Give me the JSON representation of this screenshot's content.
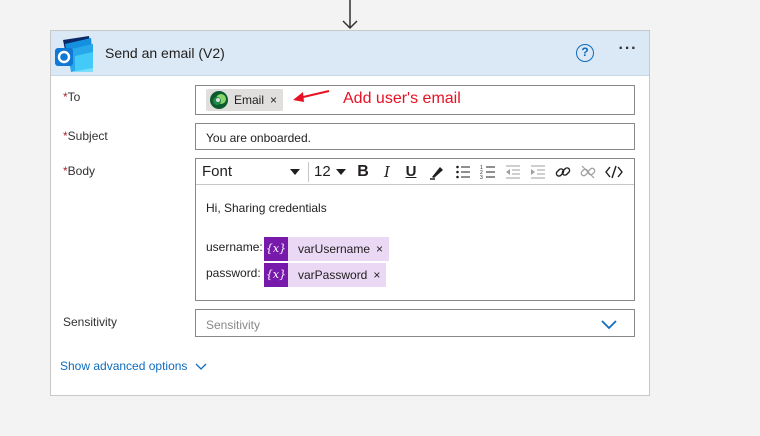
{
  "card": {
    "title": "Send an email (V2)",
    "help_glyph": "?",
    "more_glyph": "···"
  },
  "fields": {
    "to": {
      "label": "To",
      "required_mark": "*",
      "token_label": "Email",
      "token_remove": "×"
    },
    "subject": {
      "label": "Subject",
      "required_mark": "*",
      "value": "You are onboarded."
    },
    "body": {
      "label": "Body",
      "required_mark": "*",
      "toolbar": {
        "font": "Font",
        "size": "12",
        "bold": "B",
        "italic": "I",
        "underline": "U"
      },
      "greeting": "Hi, Sharing credentials",
      "rows": [
        {
          "label": "username:",
          "token": "varUsername",
          "fx": "{x}",
          "remove": "×"
        },
        {
          "label": "password:",
          "token": "varPassword",
          "fx": "{x}",
          "remove": "×"
        }
      ]
    },
    "sensitivity": {
      "label": "Sensitivity",
      "placeholder": "Sensitivity"
    }
  },
  "annotation": {
    "text": "Add user's email",
    "color": "#e81123"
  },
  "advanced": {
    "label": "Show advanced options"
  },
  "colors": {
    "accent": "#0f6cbd",
    "header_bg": "#dbe8f5",
    "token_purple": "#7719aa",
    "token_bg": "#ead8f4"
  }
}
